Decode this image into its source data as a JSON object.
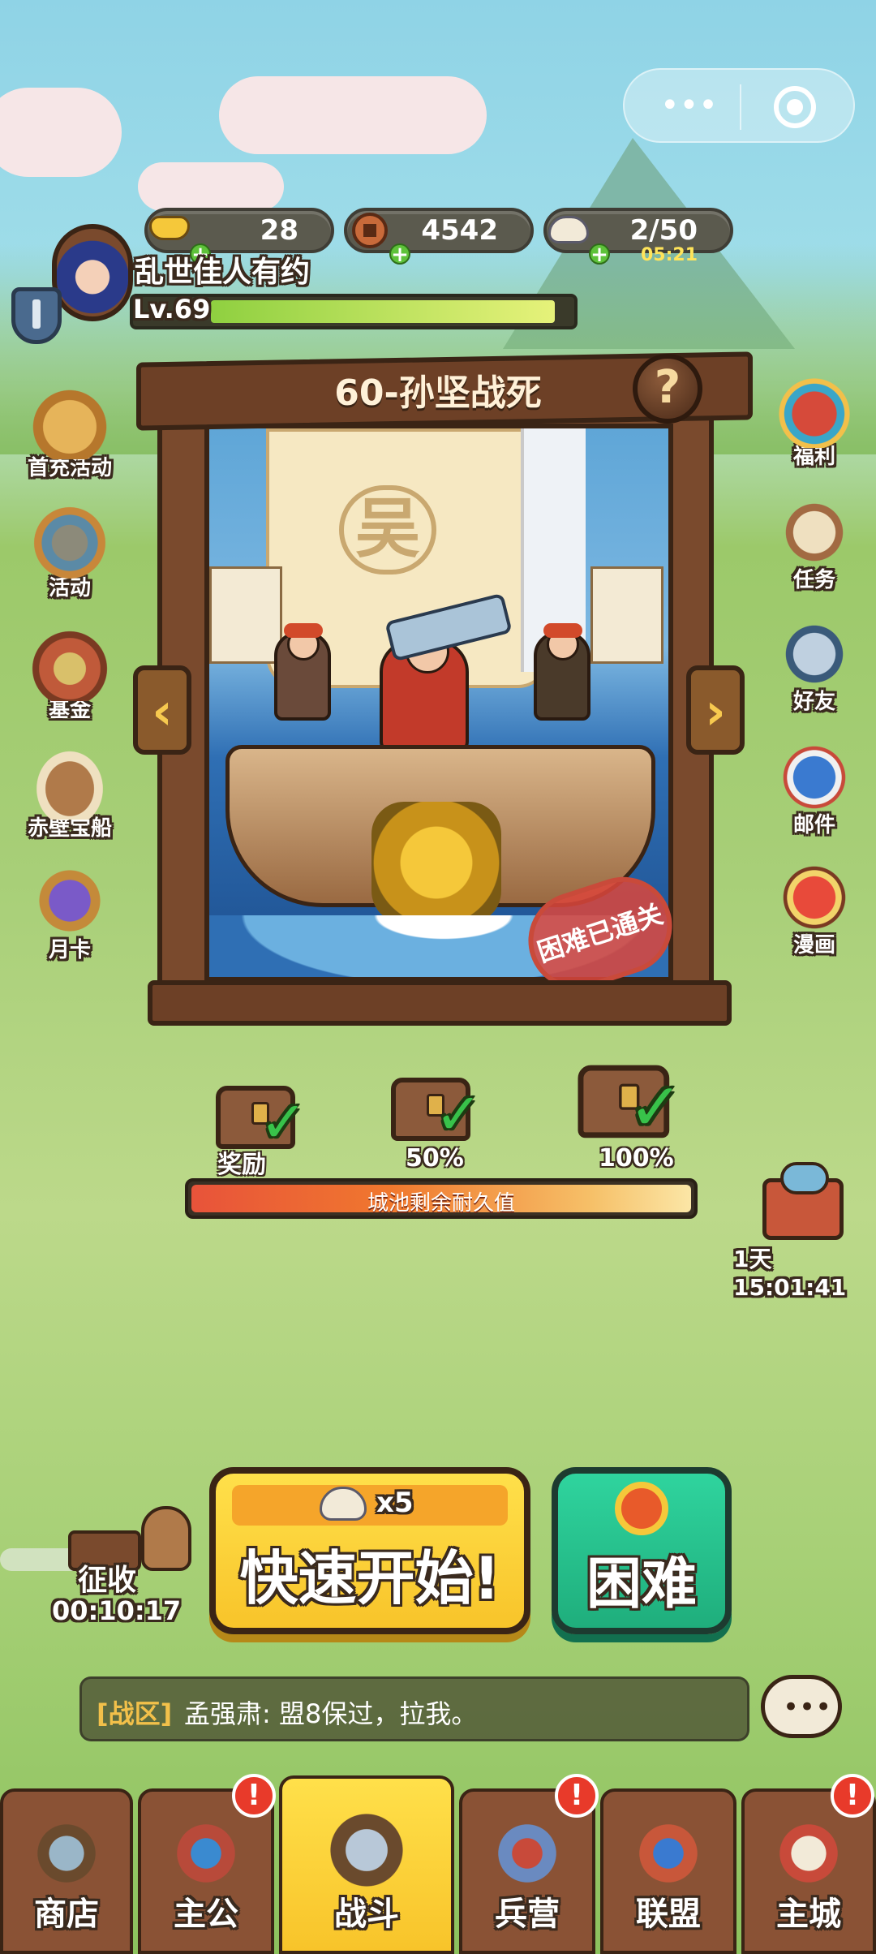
{
  "player": {
    "name": "乱世佳人有约",
    "level": "Lv.69",
    "exp_fraction": 0.88
  },
  "resources": {
    "gold": {
      "value": "28",
      "icon": "gold-ingot-icon"
    },
    "coin": {
      "value": "4542",
      "icon": "copper-coin-icon"
    },
    "food": {
      "value": "2/50",
      "timer": "05:21",
      "icon": "rice-bowl-icon"
    }
  },
  "left_menu": [
    {
      "label": "首充活动",
      "icon": "first-charge-icon"
    },
    {
      "label": "活动",
      "icon": "event-chest-icon"
    },
    {
      "label": "基金",
      "icon": "fund-icon"
    },
    {
      "label": "赤壁宝船",
      "icon": "treasure-ship-icon"
    },
    {
      "label": "月卡",
      "icon": "month-card-icon"
    }
  ],
  "right_menu": [
    {
      "label": "福利",
      "icon": "gift-box-icon"
    },
    {
      "label": "任务",
      "icon": "quest-scroll-icon"
    },
    {
      "label": "好友",
      "icon": "friends-icon"
    },
    {
      "label": "邮件",
      "icon": "mail-icon"
    },
    {
      "label": "漫画",
      "icon": "comic-icon"
    }
  ],
  "stage": {
    "title": "60-孙坚战死",
    "sail_mark": "吴",
    "stamp": "困难已通关",
    "help": "?"
  },
  "rewards": [
    {
      "label": "奖励",
      "claimed": true
    },
    {
      "label": "50%",
      "claimed": true
    },
    {
      "label": "100%",
      "claimed": true
    }
  ],
  "durability": {
    "label": "城池剩余耐久值",
    "fraction": 1.0
  },
  "timed_chest": {
    "timer": "1天 15:01:41"
  },
  "collect": {
    "label": "征收",
    "timer": "00:10:17"
  },
  "quick_start": {
    "cost": "x5",
    "label": "快速开始!"
  },
  "difficulty_button": {
    "label": "困难"
  },
  "chat": {
    "channel": "[战区]",
    "message": "孟强肃: 盟8保过，拉我。"
  },
  "nav": [
    {
      "label": "商店",
      "badge": false
    },
    {
      "label": "主公",
      "badge": true
    },
    {
      "label": "战斗",
      "badge": false,
      "active": true
    },
    {
      "label": "兵营",
      "badge": true
    },
    {
      "label": "联盟",
      "badge": false
    },
    {
      "label": "主城",
      "badge": true
    }
  ],
  "badge_mark": "!",
  "colors": {
    "accent_yellow": "#f8c42a",
    "accent_green": "#1fae7c",
    "wood": "#7a4a2d"
  }
}
